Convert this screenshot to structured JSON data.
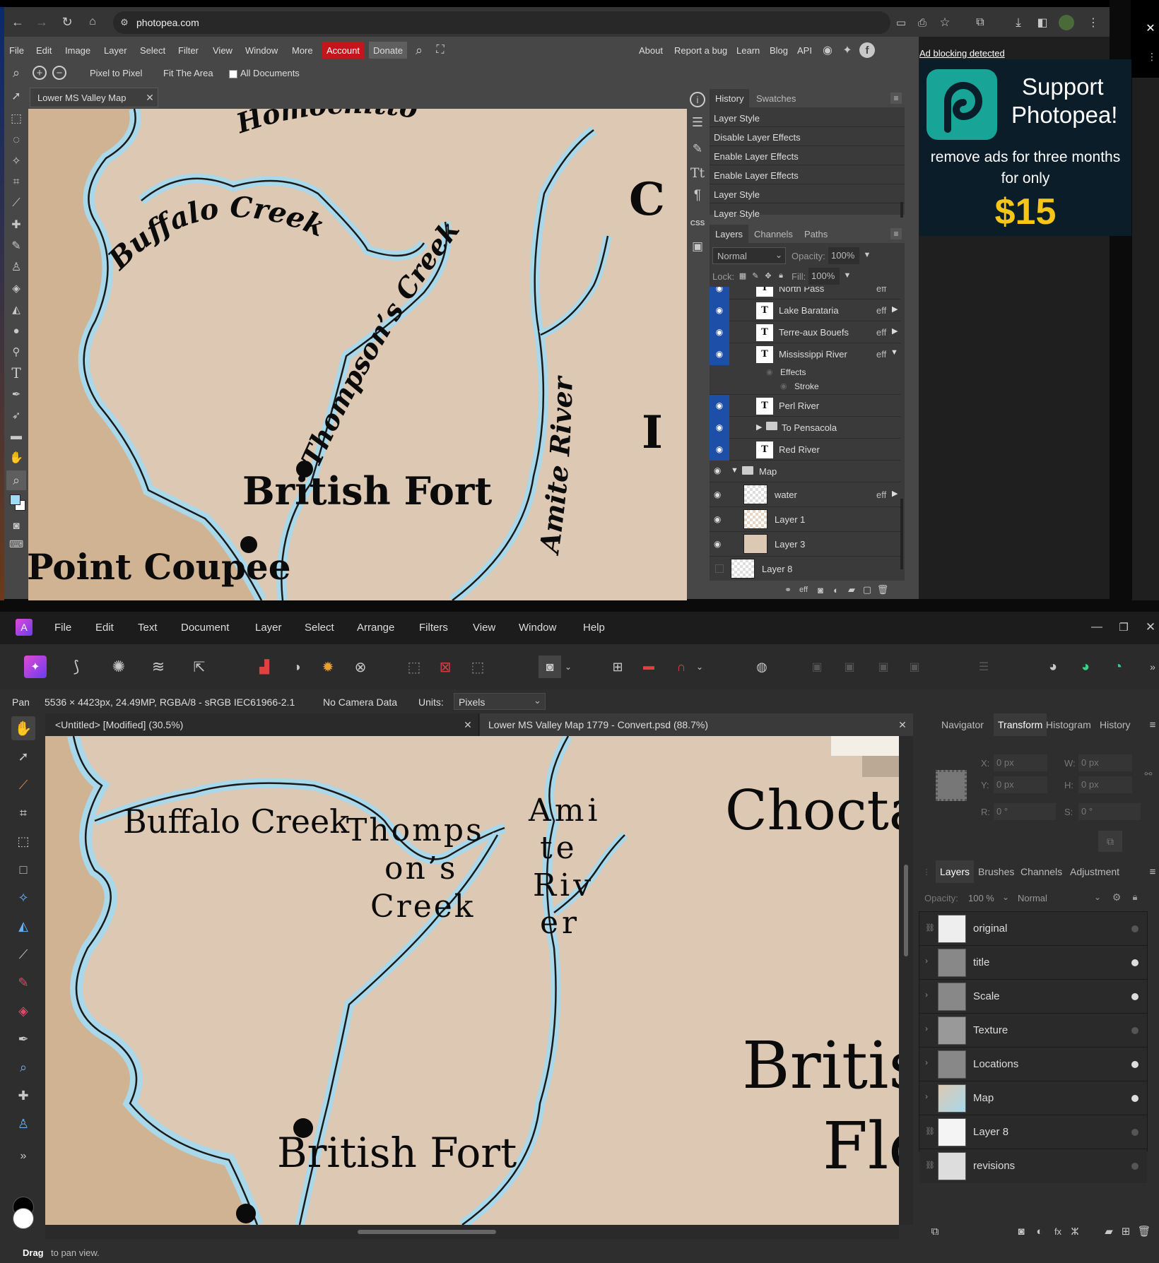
{
  "browser": {
    "url": "photopea.com",
    "close_glyph": "✕"
  },
  "photopea": {
    "menu": [
      "File",
      "Edit",
      "Image",
      "Layer",
      "Select",
      "Filter",
      "View",
      "Window",
      "More"
    ],
    "account": "Account",
    "donate": "Donate",
    "right_links": [
      "About",
      "Report a bug",
      "Learn",
      "Blog",
      "API"
    ],
    "toolbar": {
      "pixel": "Pixel to Pixel",
      "fit": "Fit The Area",
      "all_docs": "All Documents"
    },
    "doc_tab": "Lower MS Valley Map",
    "map_labels": {
      "homochitto": "Homochitto",
      "buffalo": "Buffalo Creek",
      "thompsons": "Thompson’s Creek",
      "amite": "Amite River",
      "british_fort": "British Fort",
      "point_coupee": "Point Coupee",
      "edge_c": "C",
      "edge_i": "I"
    },
    "history_tabs": [
      "History",
      "Swatches"
    ],
    "history_items": [
      "Layer Style",
      "Disable Layer Effects",
      "Enable Layer Effects",
      "Enable Layer Effects",
      "Layer Style",
      "Layer Style"
    ],
    "layer_tabs": [
      "Layers",
      "Channels",
      "Paths"
    ],
    "blend_mode": "Normal",
    "opacity_label": "Opacity:",
    "opacity": "100%",
    "lock_label": "Lock:",
    "fill_label": "Fill:",
    "fill": "100%",
    "effects_label": "Effects",
    "stroke_label": "Stroke",
    "layers": [
      {
        "name": "North Pass",
        "kind": "text",
        "eff": "eff"
      },
      {
        "name": "Lake Barataria",
        "kind": "text",
        "eff": "eff"
      },
      {
        "name": "Terre-aux Bouefs",
        "kind": "text",
        "eff": "eff"
      },
      {
        "name": "Mississippi River",
        "kind": "text",
        "eff": "eff"
      },
      {
        "name": "Perl River",
        "kind": "text",
        "eff": ""
      },
      {
        "name": "To Pensacola",
        "kind": "folder",
        "eff": ""
      },
      {
        "name": "Red River",
        "kind": "text",
        "eff": ""
      },
      {
        "name": "Map",
        "kind": "folder-open",
        "eff": ""
      },
      {
        "name": "water",
        "kind": "image",
        "eff": "eff"
      },
      {
        "name": "Layer 1",
        "kind": "image",
        "eff": ""
      },
      {
        "name": "Layer 3",
        "kind": "fill",
        "eff": ""
      },
      {
        "name": "Layer 8",
        "kind": "image",
        "eff": ""
      }
    ]
  },
  "ad": {
    "notice": "Ad blocking detected",
    "headline1": "Support",
    "headline2": "Photopea!",
    "body": "remove ads for three months for only",
    "price": "$15"
  },
  "affinity": {
    "menu": [
      "File",
      "Edit",
      "Text",
      "Document",
      "Layer",
      "Select",
      "Arrange",
      "Filters",
      "View",
      "Window",
      "Help"
    ],
    "context": {
      "tool": "Pan",
      "info": "5536 × 4423px, 24.49MP, RGBA/8 - sRGB IEC61966-2.1",
      "camera": "No Camera Data",
      "units_label": "Units:",
      "units": "Pixels"
    },
    "doc_tabs": [
      "<Untitled> [Modified] (30.5%)",
      "Lower MS Valley Map 1779 - Convert.psd (88.7%)"
    ],
    "map_labels": {
      "buffalo": "Buffalo Creek",
      "thomps": [
        "Thomps",
        "on’s",
        "Creek"
      ],
      "amite": [
        "Ami",
        "te",
        "Riv",
        "er"
      ],
      "choctaw": "Choctaw",
      "british": "Britis",
      "flo": "Flo",
      "british_fort": "British Fort"
    },
    "panel_tabs": [
      "Navigator",
      "Transform",
      "Histogram",
      "History"
    ],
    "transform": {
      "x_label": "X:",
      "x": "0 px",
      "y_label": "Y:",
      "y": "0 px",
      "w_label": "W:",
      "w": "0 px",
      "h_label": "H:",
      "h": "0 px",
      "r_label": "R:",
      "r": "0 °",
      "s_label": "S:",
      "s": "0 °"
    },
    "layer_tabs": [
      "Layers",
      "Brushes",
      "Channels",
      "Adjustment"
    ],
    "opacity_label": "Opacity:",
    "opacity": "100 %",
    "blend": "Normal",
    "layers": [
      "original",
      "title",
      "Scale",
      "Texture",
      "Locations",
      "Map",
      "Layer 8",
      "revisions"
    ],
    "status_bold": "Drag",
    "status_rest": "to pan view."
  }
}
